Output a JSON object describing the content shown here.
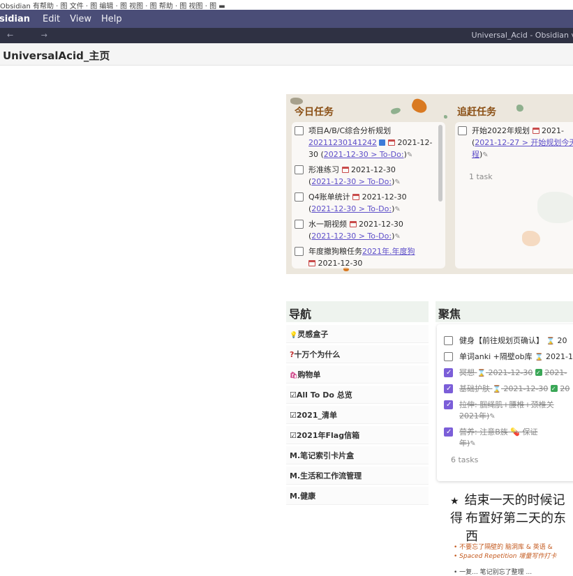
{
  "menu_row_truncated": "Obsidian 有帮助 · 图 文件 · 图 编辑 · 图 视图 · 图 帮助 · 图 视图 · 图 ▬",
  "app": {
    "brand": "sidian",
    "menus": [
      "Edit",
      "View",
      "Help"
    ],
    "window_title": "Universal_Acid - Obsidian v"
  },
  "nav_arrows": "← →",
  "note_title": "UniversalAcid_主页",
  "today": {
    "title": "今日任务",
    "tasks": [
      {
        "text": "项目A/B/C综合分析规划",
        "link": "20211230141242",
        "date": "2021-12-30",
        "due_link": "2021-12-30 > To-Do:"
      },
      {
        "text": "形准练习",
        "date": "2021-12-30",
        "due_link": "2021-12-30 > To-Do:"
      },
      {
        "text": "Q4账单统计",
        "date": "2021-12-30",
        "due_link": "2021-12-30 > To-Do:"
      },
      {
        "text": "水一期视频",
        "date": "2021-12-30",
        "due_link": "2021-12-30 > To-Do:"
      },
      {
        "text": "年度撤狗粮任务",
        "link": "2021年.年度狗",
        "date": "2021-12-30"
      }
    ]
  },
  "catchup": {
    "title": "追赶任务",
    "tasks": [
      {
        "text": "开始2022年规划",
        "date": "2021-",
        "due_link": "2021-12-27 > 开始规划今天",
        "tail": "程"
      }
    ],
    "count": "1 task"
  },
  "navigation": {
    "title": "导航",
    "items": [
      {
        "icon": "lightbulb-icon",
        "glyph": "💡",
        "label": "灵感盒子"
      },
      {
        "icon": "question-icon",
        "glyph": "?",
        "label": "十万个为什么"
      },
      {
        "icon": "shopping-bag-icon",
        "glyph": "🛍",
        "label": "购物单"
      },
      {
        "icon": "checkbox-icon",
        "glyph": "☑",
        "label": "All To Do 总览"
      },
      {
        "icon": "checkbox-icon",
        "glyph": "☑",
        "label": "2021_清单"
      },
      {
        "icon": "checkbox-icon",
        "glyph": "☑",
        "label": "2021年Flag信箱"
      },
      {
        "icon": "",
        "glyph": "",
        "label": "M.笔记索引卡片盒"
      },
      {
        "icon": "",
        "glyph": "",
        "label": "M.生活和工作流管理"
      },
      {
        "icon": "",
        "glyph": "",
        "label": "M.健康"
      }
    ]
  },
  "focus": {
    "title": "聚焦",
    "tasks": [
      {
        "text": "健身【前往规划页确认】",
        "date": "20",
        "done": false
      },
      {
        "text": "单词anki +隔壁ob库",
        "date": "2021-1",
        "done": false
      },
      {
        "text": "冥想",
        "date": "2021-12-30",
        "done_date": "2021-",
        "done": true
      },
      {
        "text": "基础护肤",
        "date": "2021-12-30",
        "done_date": "20",
        "done": true
      },
      {
        "text": "拉伸: 腘绳肌+腰椎+颈椎关",
        "tail": "2021年)",
        "done": true
      },
      {
        "text": "营养: 注意B族",
        "tail": "保证",
        "tail2": "年)",
        "done": true
      }
    ],
    "count": "6 tasks"
  },
  "reminder": {
    "line1": "结束一天的时候记得",
    "line2": "布置好第二天的东西",
    "note1": "不要忘了隔壁的 脑洞库 & 英语 &",
    "note2": "Spaced Repetition 增量写作打卡",
    "note3": "一复... 笔记别忘了整理 ..."
  },
  "colors": {
    "appbar": "#4a4d77",
    "titlebar": "#2f3143",
    "accent": "#7b5ed8",
    "panel_title": "#8a4f14",
    "link": "#5d4ec9"
  }
}
